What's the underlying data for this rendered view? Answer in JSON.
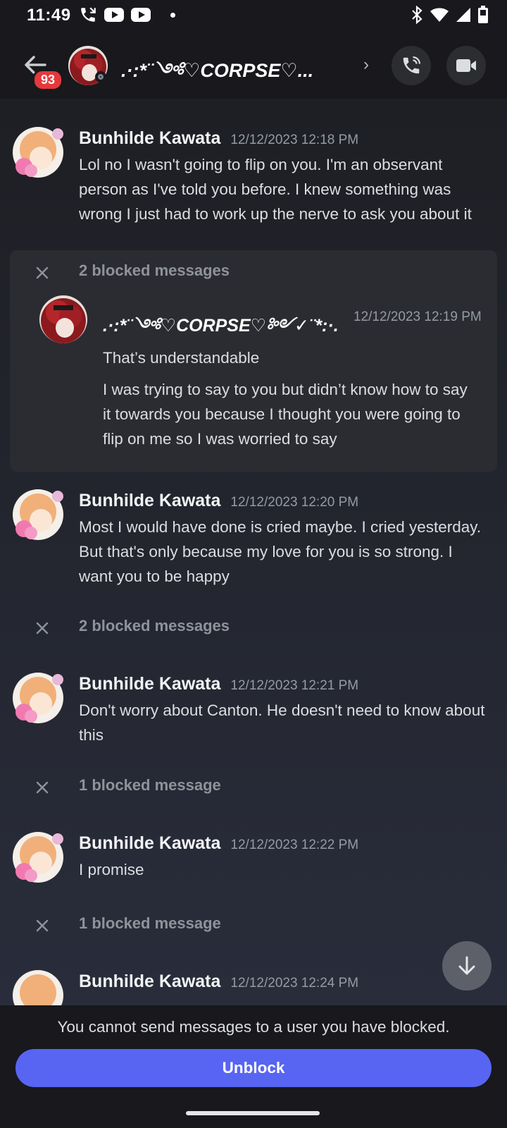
{
  "status_bar": {
    "time": "11:49",
    "icons": [
      "phone-missed-icon",
      "youtube-icon",
      "youtube-icon",
      "dot-icon",
      "bluetooth-icon",
      "wifi-icon",
      "signal-icon",
      "battery-icon"
    ]
  },
  "header": {
    "back_badge": "93",
    "title": ".·:*¨༺♡CORPSE♡...",
    "status": "offline",
    "icons": [
      "back-arrow-icon",
      "chevron-right-icon",
      "voice-call-icon",
      "video-call-icon"
    ]
  },
  "colors": {
    "accent": "#5865f2",
    "badge": "#e5383c",
    "background": "#1f2028",
    "header": "#18181d"
  },
  "messages": [
    {
      "author": "Bunhilde Kawata",
      "timestamp": "12/12/2023 12:18 PM",
      "text": "Lol no I wasn't going to flip on you. I'm an observant person as I've told you before. I knew something was wrong I just had to work up the nerve to ask you about it"
    },
    {
      "author": "Bunhilde Kawata",
      "timestamp": "12/12/2023 12:20 PM",
      "text": "Most I would have done is cried maybe. I cried yesterday. But that's only because my love for you is so strong. I want you to be happy"
    },
    {
      "author": "Bunhilde Kawata",
      "timestamp": "12/12/2023 12:21 PM",
      "text": "Don't worry about Canton. He doesn't need to know about this"
    },
    {
      "author": "Bunhilde Kawata",
      "timestamp": "12/12/2023 12:22 PM",
      "text": "I promise"
    },
    {
      "author": "Bunhilde Kawata",
      "timestamp": "12/12/2023 12:24 PM",
      "text": ""
    }
  ],
  "blocked_groups": [
    {
      "label": "2 blocked messages",
      "expanded": true,
      "author": ".·:*¨༺♡CORPSE♡༻✓¨*:·.",
      "timestamp": "12/12/2023 12:19 PM",
      "line1": "That’s understandable",
      "line2": "I was trying to say to you but didn’t know how to say it towards you because I thought you were going to flip on me so I was worried to say"
    },
    {
      "label": "2 blocked messages",
      "expanded": false
    },
    {
      "label": "1 blocked message",
      "expanded": false
    },
    {
      "label": "1 blocked message",
      "expanded": false
    }
  ],
  "footer": {
    "notice": "You cannot send messages to a user you have blocked.",
    "unblock_label": "Unblock"
  }
}
